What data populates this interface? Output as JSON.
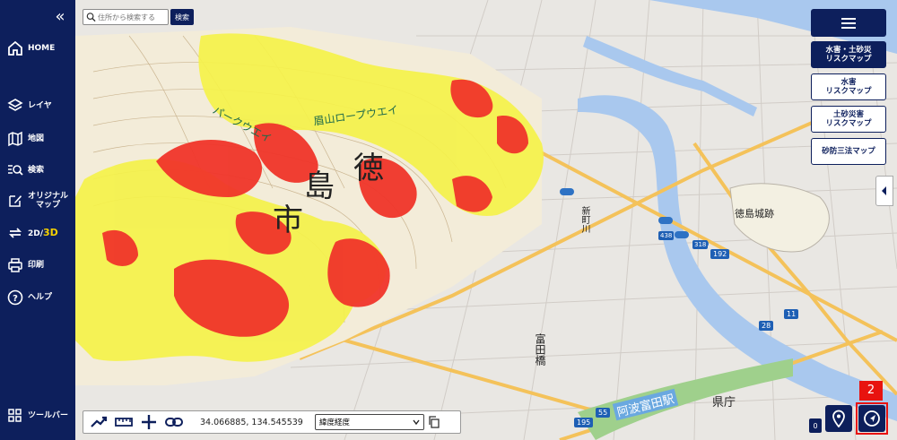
{
  "sidebar": {
    "items": [
      {
        "label": "HOME",
        "icon": "home-icon"
      },
      {
        "label": "レイヤ",
        "icon": "layers-icon"
      },
      {
        "label": "地図",
        "icon": "map-icon"
      },
      {
        "label": "検索",
        "icon": "search-list-icon"
      },
      {
        "label": "オリジナル\nマップ",
        "icon": "edit-icon"
      },
      {
        "label_main": "2D/",
        "label_accent": "3D",
        "icon": "swap-icon"
      },
      {
        "label": "印刷",
        "icon": "printer-icon"
      },
      {
        "label": "ヘルプ",
        "icon": "help-icon"
      },
      {
        "label": "ツールバー",
        "icon": "grid-icon"
      }
    ],
    "collapse_glyph": "«"
  },
  "search": {
    "placeholder": "住所から検索する",
    "button_label": "検索"
  },
  "right_panel": {
    "buttons": [
      {
        "label": "水害・土砂災\nリスクマップ",
        "active": true
      },
      {
        "label": "水害\nリスクマップ",
        "active": false
      },
      {
        "label": "土砂災害\nリスクマップ",
        "active": false
      },
      {
        "label": "砂防三法マップ",
        "active": false
      }
    ]
  },
  "toolbar": {
    "coordinates": "34.066885, 134.545539",
    "coord_format": "緯度経度"
  },
  "zoom_badge": "0",
  "annotation_tag": "2",
  "map_labels": {
    "city_char_1": "徳",
    "city_char_2": "島",
    "city_char_3": "市",
    "ropeway": "眉山ロープウエイ",
    "ropeway_2": "パークウエイ",
    "castle": "徳島城跡",
    "prefecture_office": "県庁",
    "tomida": "富田橋",
    "awa_tomida": "阿波富田駅",
    "shinmachi": "新町川",
    "route_55": "55",
    "route_192": "192",
    "route_195": "195",
    "route_11": "11",
    "route_28": "28",
    "route_438": "438",
    "route_318": "318"
  },
  "colors": {
    "brand_navy": "#0d1f5c",
    "hazard_red": "#f0352a",
    "hazard_yellow": "#f5f24a",
    "river_blue": "#a9c8ee",
    "road_orange": "#f4c25a",
    "highlight_red": "#e8130f",
    "accent_yellow": "#f5d000"
  }
}
